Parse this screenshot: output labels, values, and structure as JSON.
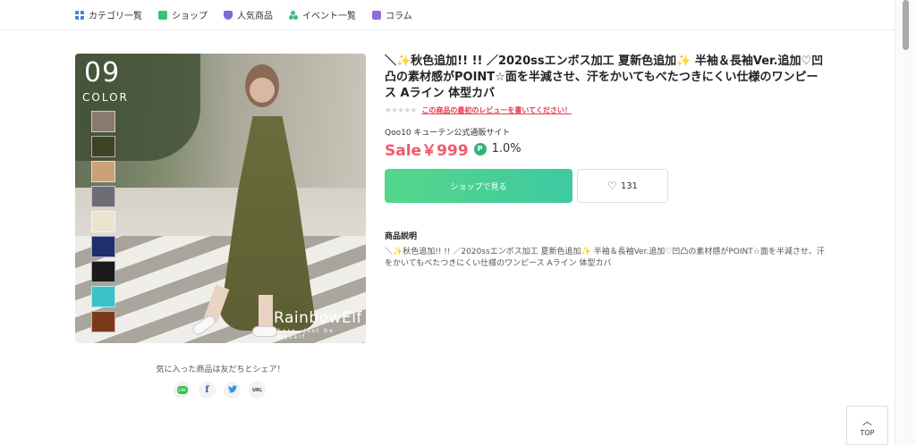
{
  "nav": {
    "items": [
      {
        "label": "カテゴリ一覧",
        "icon": "grid-icon"
      },
      {
        "label": "ショップ",
        "icon": "shop-icon"
      },
      {
        "label": "人気商品",
        "icon": "crown-icon"
      },
      {
        "label": "イベント一覧",
        "icon": "event-icon"
      },
      {
        "label": "コラム",
        "icon": "column-icon"
      }
    ]
  },
  "image": {
    "color_count": "09",
    "color_word": "COLOR",
    "brand": "RainbowElf",
    "brand_tagline": "here, just be myself",
    "swatches": [
      "#8a7a6e",
      "#3f4326",
      "#c9a27a",
      "#6d6d73",
      "#ece3cf",
      "#1f2f6b",
      "#1b1b1b",
      "#3bc2c8",
      "#7a3a1a"
    ]
  },
  "product": {
    "title": "＼✨秋色追加!! !! ／2020ssエンボス加工 夏新色追加✨ 半袖＆長袖Ver.追加♡凹凸の素材感がPOINT☆面を半減させ、汗をかいてもべたつきにくい仕様のワンピース Aライン 体型カバ",
    "stars": "★★★★★",
    "review_link": "この商品の最初のレビューを書いてください！",
    "shop": "Qoo10 キューテン公式通販サイト",
    "price": "Sale￥999",
    "point_badge": "P",
    "point_rate": "1.0%",
    "shop_button": "ショップで見る",
    "like_count": "131",
    "desc_heading": "商品説明",
    "description": "＼✨秋色追加!! !! ／2020ssエンボス加工 夏新色追加✨ 半袖＆長袖Ver.追加♡凹凸の素材感がPOINT☆面を半減させ、汗をかいてもべたつきにくい仕様のワンピース Aライン 体型カバ"
  },
  "share": {
    "label": "気に入った商品は友だちとシェア！",
    "line": "LINE",
    "facebook": "f",
    "twitter": "🐦",
    "url": "URL"
  },
  "top_button": {
    "label": "TOP",
    "arrow": "︿"
  },
  "colors": {
    "price": "#f05a6b",
    "accent_green": "#3fc9a1",
    "review_link": "#e23a4e"
  }
}
